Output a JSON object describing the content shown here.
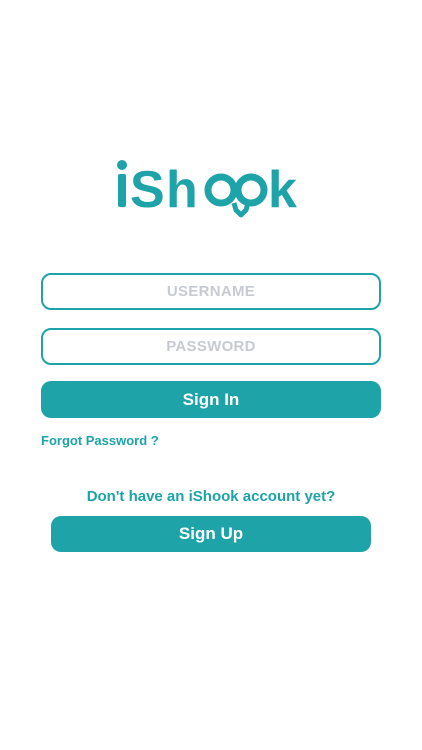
{
  "app": {
    "logo_text": "iShook",
    "brand_color": "#1ea3a8"
  },
  "login": {
    "username_placeholder": "USERNAME",
    "password_placeholder": "PASSWORD",
    "sign_in_label": "Sign In",
    "forgot_password_label": "Forgot Password ?"
  },
  "signup": {
    "prompt_text": "Don't have an iShook account yet?",
    "sign_up_label": "Sign Up"
  }
}
